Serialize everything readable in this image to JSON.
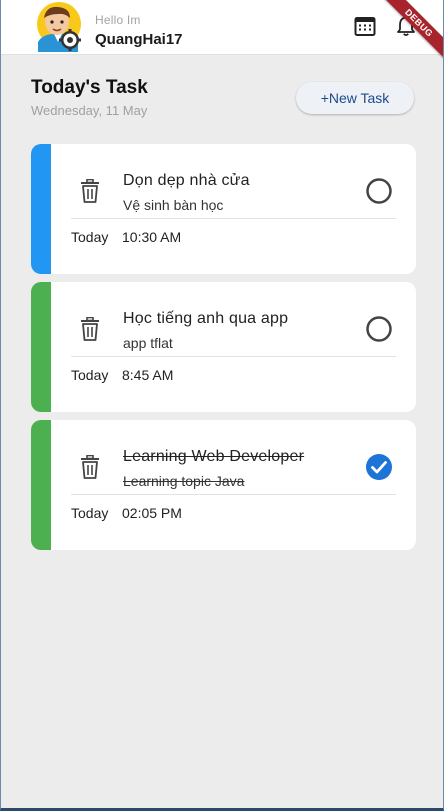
{
  "appbar": {
    "greeting": "Hello Im",
    "username": "QuangHai17",
    "icons": [
      "avatar-image",
      "calendar-icon",
      "bell-icon"
    ],
    "debug_label": "DEBUG"
  },
  "header": {
    "title": "Today's Task",
    "date": "Wednesday, 11 May",
    "new_task_label": "+New Task"
  },
  "tasks": [
    {
      "title": "Dọn dẹp nhà cửa",
      "subtitle": "Vệ sinh bàn học",
      "day": "Today",
      "time": "10:30 AM",
      "done": false,
      "accent": "#2196f3"
    },
    {
      "title": "Học tiếng anh qua app",
      "subtitle": "app tflat",
      "day": "Today",
      "time": "8:45 AM",
      "done": false,
      "accent": "#4caf50"
    },
    {
      "title": "Learning Web Developer",
      "subtitle": "Learning topic Java",
      "day": "Today",
      "time": "02:05 PM",
      "done": true,
      "accent": "#4caf50"
    }
  ],
  "colors": {
    "check_done": "#1e73d6",
    "check_empty": "#444444"
  }
}
